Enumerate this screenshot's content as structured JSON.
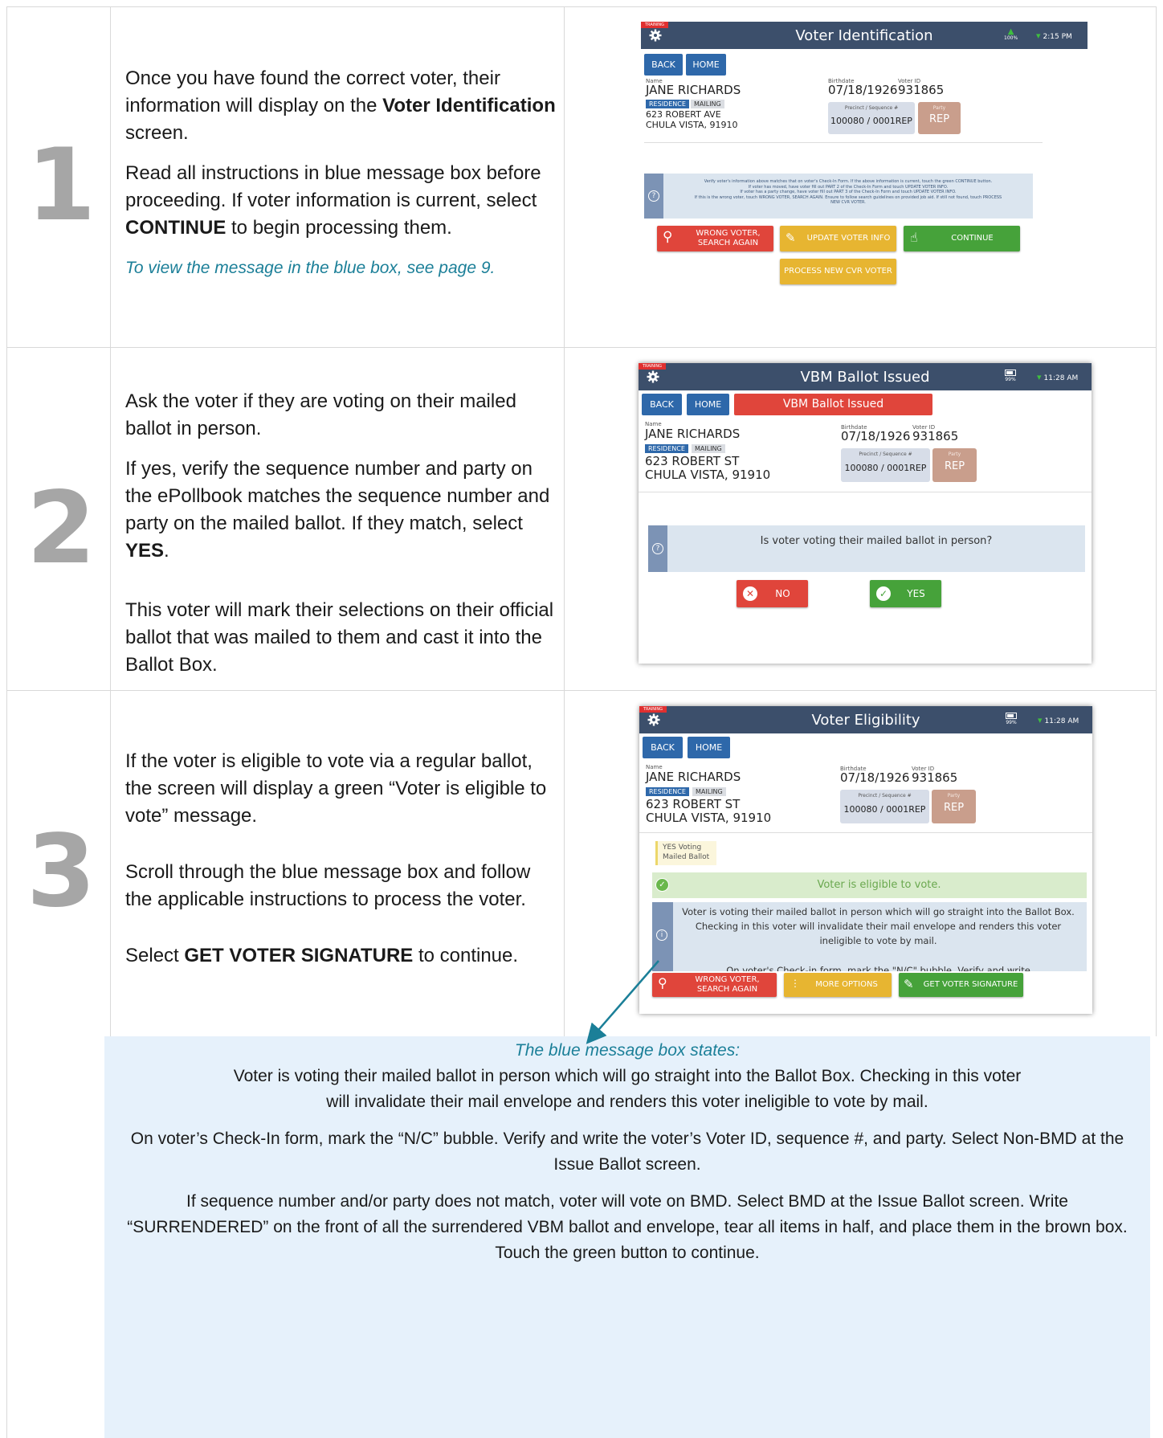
{
  "steps": [
    {
      "number": "1",
      "paragraphs": [
        [
          "Once you have found the correct voter, their information will display on the ",
          "Voter Identification",
          " screen."
        ],
        [
          "Read all instructions in blue message box before proceeding. If voter information is current, select ",
          "CONTINUE",
          " to begin processing them."
        ]
      ],
      "reference": "To view the message in the blue box, see page 9.",
      "screen": {
        "training": "TRAINING",
        "title": "Voter Identification",
        "battery": "100%",
        "time": "2:15 PM",
        "back": "BACK",
        "home": "HOME",
        "name_label": "Name",
        "name": "JANE RICHARDS",
        "residence": "RESIDENCE",
        "mailing": "MAILING",
        "address1": "623 ROBERT  AVE",
        "address2": "CHULA VISTA, 91910",
        "birthdate_label": "Birthdate",
        "birthdate": "07/18/1926",
        "voterid_label": "Voter ID",
        "voterid": "931865",
        "precinct_label": "Precinct / Sequence #",
        "precinct": "100080 / 0001REP",
        "party_label": "Party",
        "party": "REP",
        "message_lines": [
          "Verify voter's information above matches that on voter's Check-In Form. If the above information is current, touch the green CONTINUE button.",
          "If voter has moved, have voter fill out PART 2 of the Check-In Form and touch UPDATE VOTER INFO.",
          "If voter has a party change, have voter fill out PART 3 of the Check-In Form and touch UPDATE VOTER INFO.",
          "If this is the wrong voter, touch WRONG VOTER, SEARCH AGAIN. Ensure to follow search guidelines on provided job aid. If still not found, touch PROCESS",
          "NEW CVR VOTER."
        ],
        "btn_wrong_1": "WRONG VOTER,",
        "btn_wrong_2": "SEARCH AGAIN",
        "btn_update": "UPDATE VOTER INFO",
        "btn_continue": "CONTINUE",
        "btn_process": "PROCESS NEW CVR VOTER"
      }
    },
    {
      "number": "2",
      "paragraphs": [
        [
          "Ask the voter if they are voting on their mailed ballot in person."
        ],
        [
          "If yes, verify the sequence number and party on the ePollbook matches the sequence number and party on the mailed ballot. If they match, select ",
          "YES",
          "."
        ],
        [
          "This voter will mark their selections on their official ballot that was mailed to them and cast it into the Ballot Box."
        ]
      ],
      "screen": {
        "training": "TRAINING",
        "title": "VBM Ballot Issued",
        "battery": "99%",
        "time": "11:28 AM",
        "back": "BACK",
        "home": "HOME",
        "banner": "VBM Ballot Issued",
        "name_label": "Name",
        "name": "JANE RICHARDS",
        "residence": "RESIDENCE",
        "mailing": "MAILING",
        "address1": "623 ROBERT  ST",
        "address2": "CHULA VISTA, 91910",
        "birthdate_label": "Birthdate",
        "birthdate": "07/18/1926",
        "voterid_label": "Voter ID",
        "voterid": "931865",
        "precinct_label": "Precinct / Sequence #",
        "precinct": "100080 / 0001REP",
        "party_label": "Party",
        "party": "REP",
        "question": "Is voter voting their mailed ballot in person?",
        "no": "NO",
        "yes": "YES"
      }
    },
    {
      "number": "3",
      "paragraphs": [
        [
          "If the voter is eligible to vote via a regular ballot, the screen will display a green “Voter is eligible to vote” message."
        ],
        [
          "Scroll through the blue message box and follow the applicable instructions to process the voter."
        ],
        [
          "Select ",
          "GET VOTER SIGNATURE",
          " to continue."
        ]
      ],
      "screen": {
        "training": "TRAINING",
        "title": "Voter Eligibility",
        "battery": "99%",
        "time": "11:28 AM",
        "back": "BACK",
        "home": "HOME",
        "name_label": "Name",
        "name": "JANE RICHARDS",
        "residence": "RESIDENCE",
        "mailing": "MAILING",
        "address1": "623 ROBERT  ST",
        "address2": "CHULA VISTA, 91910",
        "birthdate_label": "Birthdate",
        "birthdate": "07/18/1926",
        "voterid_label": "Voter ID",
        "voterid": "931865",
        "precinct_label": "Precinct / Sequence #",
        "precinct": "100080 / 0001REP",
        "party_label": "Party",
        "party": "REP",
        "note_1": "YES Voting",
        "note_2": "Mailed Ballot",
        "eligible": "Voter is eligible to vote.",
        "message": "Voter is voting their mailed ballot in person which will go straight into the Ballot Box. Checking in this voter will invalidate their mail envelope and renders this voter ineligible to vote by mail.",
        "message_cut": "On voter's Check-in form, mark the \"N/C\" bubble. Verify and write",
        "btn_wrong_1": "WRONG VOTER,",
        "btn_wrong_2": "SEARCH AGAIN",
        "btn_more": "MORE OPTIONS",
        "btn_signature": "GET VOTER SIGNATURE"
      }
    }
  ],
  "blue_box": {
    "heading": "The blue message box states:",
    "p1": "Voter is voting their mailed ballot in person which will go straight into the Ballot Box. Checking in this voter will invalidate their mail envelope and renders this voter ineligible to vote by mail.",
    "p2": "On voter’s Check-In form, mark the “N/C” bubble. Verify and write the voter’s Voter ID, sequence #, and party. Select Non-BMD at the Issue Ballot screen.",
    "p3": "If sequence number and/or party does not match, voter will vote on BMD. Select BMD at the Issue Ballot screen. Write “SURRENDERED” on the front of all the surrendered VBM ballot and envelope, tear all items in half, and place them in the brown box.",
    "p4": "Touch the green button to continue."
  },
  "colors": {
    "step_number": "#a6a6a6",
    "link_teal": "#1b7f98",
    "blue_box_bg": "#e6f1fb",
    "topbar": "#3c4f6b",
    "button_blue": "#2e68aa",
    "red": "#e0453b",
    "yellow": "#e7b531",
    "green": "#46a23a"
  }
}
